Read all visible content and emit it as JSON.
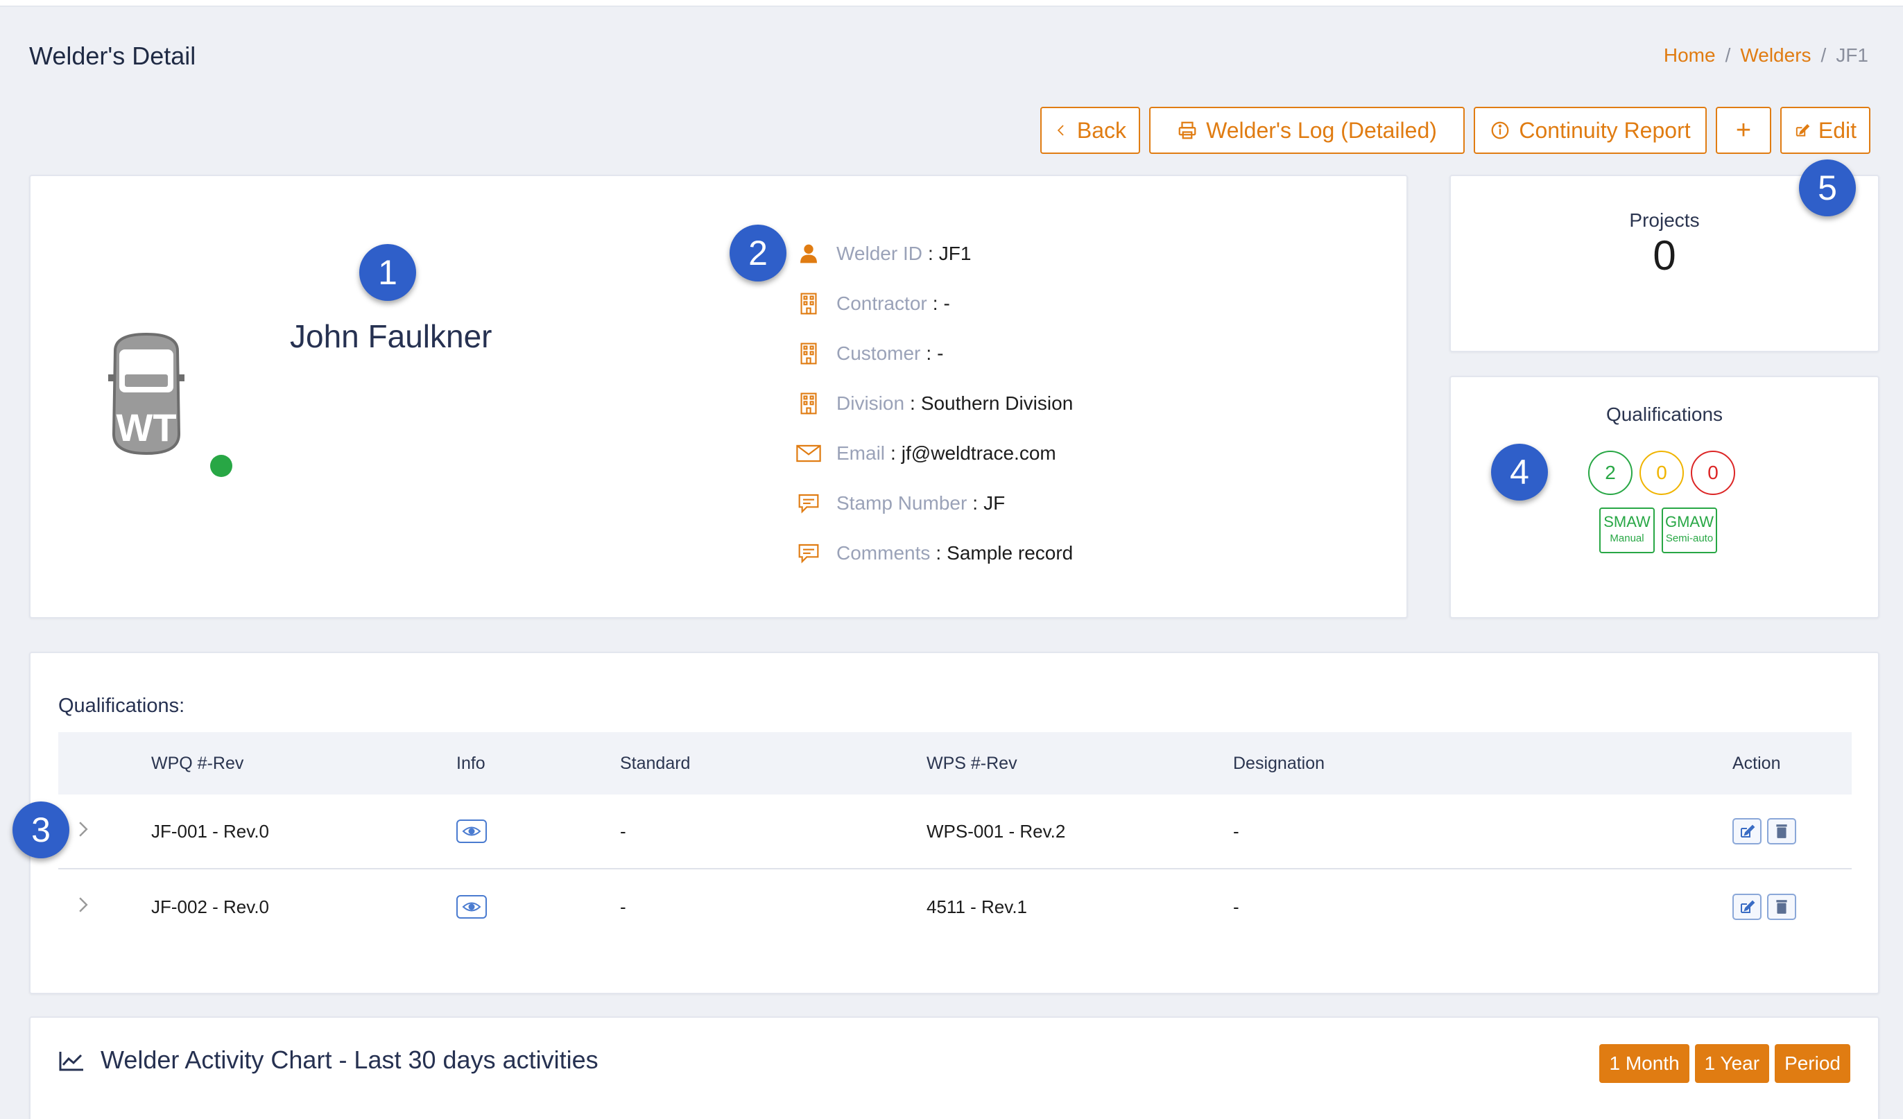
{
  "page": {
    "title": "Welder's Detail"
  },
  "breadcrumb": {
    "home": "Home",
    "welders": "Welders",
    "current": "JF1",
    "sep": "/"
  },
  "toolbar": {
    "back": "Back",
    "log": "Welder's Log (Detailed)",
    "continuity": "Continuity Report",
    "add": "+",
    "edit": "Edit"
  },
  "annotations": [
    "1",
    "2",
    "3",
    "4",
    "5"
  ],
  "profile": {
    "name": "John Faulkner",
    "avatar_text": "WT",
    "status_color": "#28a745"
  },
  "info": [
    {
      "icon": "person-icon",
      "label": "Welder ID",
      "value": "JF1"
    },
    {
      "icon": "building-icon",
      "label": "Contractor",
      "value": "-"
    },
    {
      "icon": "building-icon",
      "label": "Customer",
      "value": "-"
    },
    {
      "icon": "building-icon",
      "label": "Division",
      "value": "Southern Division"
    },
    {
      "icon": "mail-icon",
      "label": "Email",
      "value": "jf@weldtrace.com"
    },
    {
      "icon": "comment-icon",
      "label": "Stamp Number",
      "value": "JF"
    },
    {
      "icon": "comment-icon",
      "label": "Comments",
      "value": "Sample record"
    }
  ],
  "projects": {
    "title": "Projects",
    "value": "0"
  },
  "qualifications_card": {
    "title": "Qualifications",
    "counts": [
      {
        "value": "2",
        "color": "#28a745"
      },
      {
        "value": "0",
        "color": "#f0b400"
      },
      {
        "value": "0",
        "color": "#dc2626"
      }
    ],
    "tags": [
      {
        "process": "SMAW",
        "mode": "Manual"
      },
      {
        "process": "GMAW",
        "mode": "Semi-auto"
      }
    ]
  },
  "qualifications_table": {
    "heading": "Qualifications:",
    "columns": [
      "WPQ #-Rev",
      "Info",
      "Standard",
      "WPS #-Rev",
      "Designation",
      "Action"
    ],
    "rows": [
      {
        "wpq": "JF-001 - Rev.0",
        "standard": "-",
        "wps": "WPS-001 - Rev.2",
        "designation": "-"
      },
      {
        "wpq": "JF-002 - Rev.0",
        "standard": "-",
        "wps": "4511 - Rev.1",
        "designation": "-"
      }
    ]
  },
  "activity": {
    "title": "Welder Activity Chart - Last 30 days activities",
    "periods": [
      "1 Month",
      "1 Year",
      "Period"
    ]
  },
  "colors": {
    "accent": "#e07c12",
    "badge": "#2f5fc9",
    "heading": "#263151"
  }
}
